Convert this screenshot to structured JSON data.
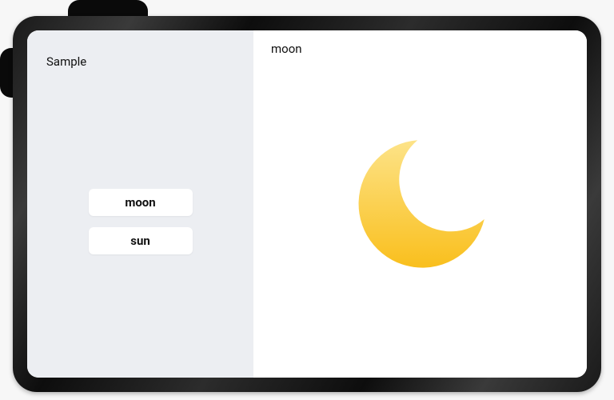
{
  "sidebar": {
    "title": "Sample",
    "items": [
      {
        "label": "moon"
      },
      {
        "label": "sun"
      }
    ]
  },
  "content": {
    "title": "moon",
    "icon": "moon-icon"
  },
  "colors": {
    "moon_top": "#fde388",
    "moon_bottom": "#f9bf1d"
  }
}
